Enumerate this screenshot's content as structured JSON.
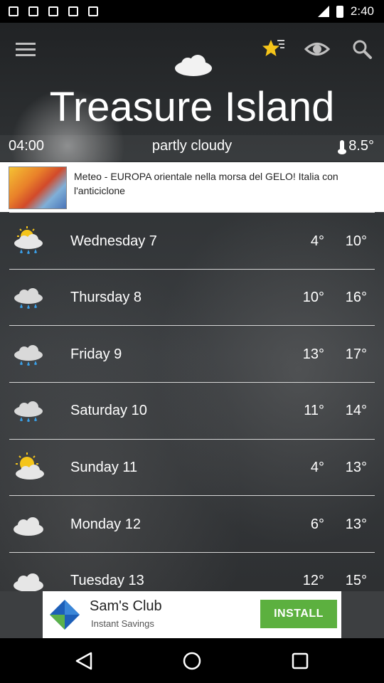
{
  "status_bar": {
    "time": "2:40"
  },
  "location": {
    "title": "Treasure Island"
  },
  "current": {
    "time": "04:00",
    "condition": "partly cloudy",
    "temperature": "8.5°"
  },
  "news": {
    "headline": "Meteo - EUROPA orientale nella morsa del GELO! Italia con l'anticiclone"
  },
  "forecast": [
    {
      "day": "Wednesday 7",
      "low": "4°",
      "high": "10°",
      "icon": "sun-cloud-rain-icon"
    },
    {
      "day": "Thursday 8",
      "low": "10°",
      "high": "16°",
      "icon": "cloud-rain-icon"
    },
    {
      "day": "Friday 9",
      "low": "13°",
      "high": "17°",
      "icon": "cloud-rain-icon"
    },
    {
      "day": "Saturday 10",
      "low": "11°",
      "high": "14°",
      "icon": "cloud-rain-icon"
    },
    {
      "day": "Sunday 11",
      "low": "4°",
      "high": "13°",
      "icon": "sun-cloud-icon"
    },
    {
      "day": "Monday 12",
      "low": "6°",
      "high": "13°",
      "icon": "cloud-icon"
    },
    {
      "day": "Tuesday 13",
      "low": "12°",
      "high": "15°",
      "icon": "cloud-icon"
    }
  ],
  "ad": {
    "title": "Sam's Club",
    "subtitle": "Instant Savings",
    "button": "INSTALL"
  },
  "colors": {
    "install_button": "#5cb03f",
    "star": "#f5c51a"
  }
}
